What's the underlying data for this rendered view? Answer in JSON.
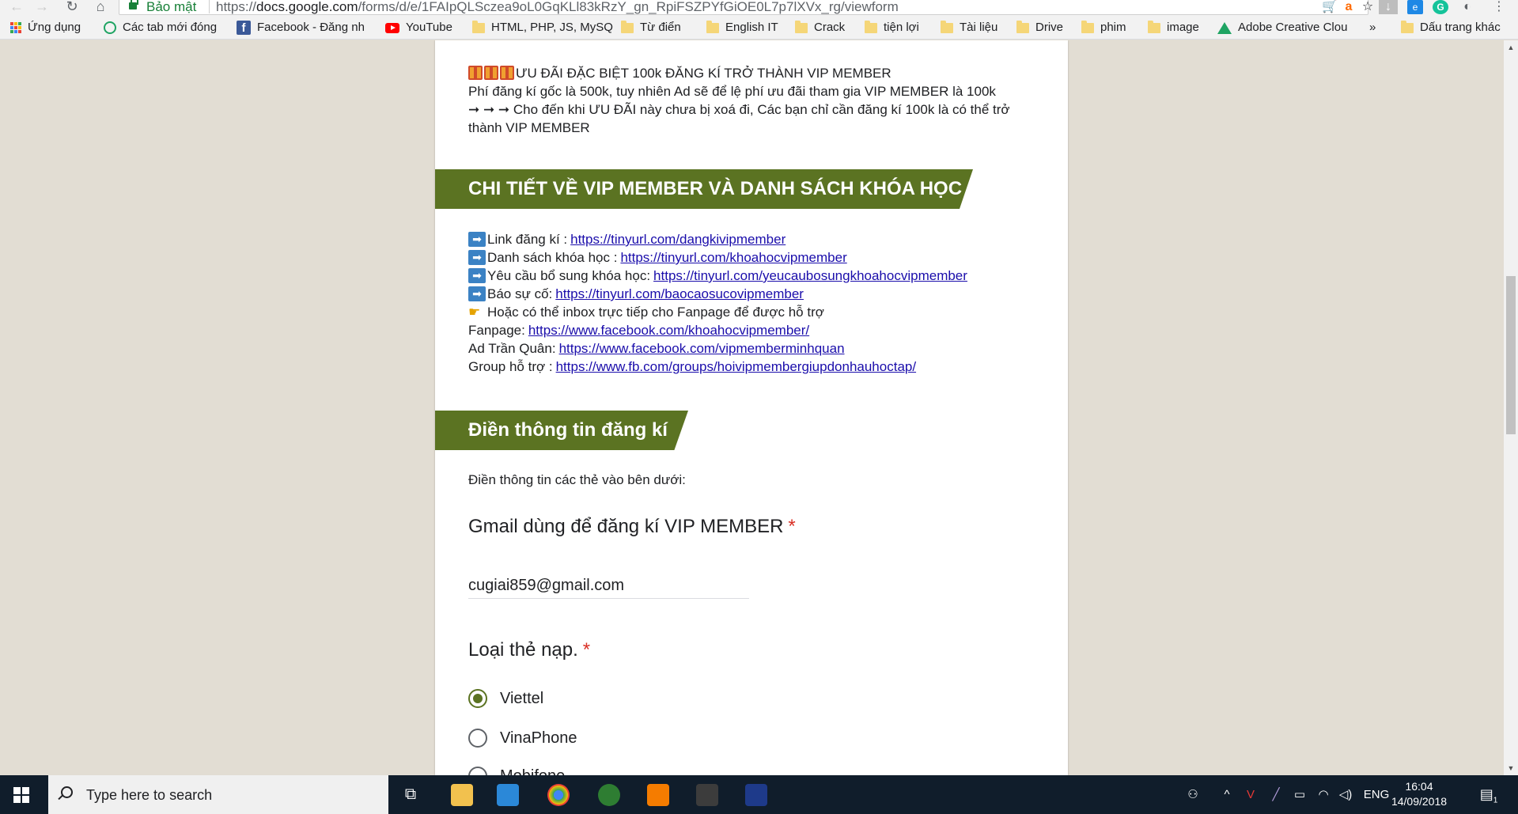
{
  "browser": {
    "secure_label": "Bảo mật",
    "url_scheme": "https://",
    "url_host": "docs.google.com",
    "url_path": "/forms/d/e/1FAIpQLSczea9oL0GqKLl83kRzY_gn_RpiFSZPYfGiOE0L7p7lXVx_rg/viewform",
    "bookmarks": {
      "apps": "Ứng dụng",
      "recent_tabs": "Các tab mới đóng",
      "facebook": "Facebook - Đăng nh",
      "youtube": "YouTube",
      "html": "HTML, PHP, JS, MySQ",
      "dictionary": "Từ điển",
      "english": "English IT",
      "crack": "Crack",
      "utilities": "tiện lợi",
      "documents": "Tài liệu",
      "drive": "Drive",
      "movies": "phim",
      "image": "image",
      "adobe": "Adobe Creative Clou",
      "more": "»",
      "other": "Dấu trang khác"
    }
  },
  "form": {
    "promo": {
      "headline": "ƯU ĐÃI ĐẶC BIỆT 100k ĐĂNG KÍ TRỞ THÀNH VIP MEMBER",
      "line2": "Phí đăng kí gốc là 500k, tuy nhiên Ad sẽ để lệ phí ưu đãi tham gia VIP MEMBER là 100k",
      "line3": "➞ ➞ ➞ Cho đến khi ƯU ĐÃI này chưa bị xoá đi, Các bạn chỉ cần đăng kí 100k là có thể trở thành VIP MEMBER"
    },
    "section1_title": "CHI TIẾT VỀ VIP MEMBER VÀ DANH SÁCH KHÓA HỌC",
    "links": [
      {
        "label": "Link đăng kí :",
        "url": "https://tinyurl.com/dangkivipmember",
        "icon": "arrow-box-icon"
      },
      {
        "label": "Danh sách khóa học :",
        "url": "https://tinyurl.com/khoahocvipmember",
        "icon": "arrow-box-icon"
      },
      {
        "label": "Yêu cầu bổ sung khóa học:",
        "url": "https://tinyurl.com/yeucaubosungkhoahocvipmember",
        "icon": "arrow-box-icon"
      },
      {
        "label": "Báo sự cố:",
        "url": "https://tinyurl.com/baocaosucovipmember",
        "icon": "arrow-box-icon"
      }
    ],
    "inbox_note": "Hoặc có thể inbox trực tiếp cho Fanpage để được hỗ trợ",
    "contacts": [
      {
        "label": "Fanpage:",
        "url": "https://www.facebook.com/khoahocvipmember/"
      },
      {
        "label": "Ad Trần Quân:",
        "url": "https://www.facebook.com/vipmemberminhquan"
      },
      {
        "label": "Group hỗ trợ :",
        "url": "https://www.fb.com/groups/hoivipmembergiupdonhauhoctap/"
      }
    ],
    "section2_title": "Điền thông tin đăng kí",
    "section2_intro": "Điền thông tin các thẻ vào bên dưới:",
    "q_email": {
      "title": "Gmail dùng để đăng kí VIP MEMBER",
      "required_mark": "*",
      "value": "cugiai859@gmail.com"
    },
    "q_card": {
      "title": "Loại thẻ nạp.",
      "required_mark": "*",
      "options": [
        "Viettel",
        "VinaPhone",
        "Mobifone"
      ],
      "selected": "Viettel"
    }
  },
  "taskbar": {
    "search_placeholder": "Type here to search",
    "language": "ENG",
    "time": "16:04",
    "date": "14/09/2018",
    "notification_count": "1"
  },
  "colors": {
    "accent": "#5b7322",
    "page_bg": "#e2ddd3",
    "link": "#1a0dab",
    "required": "#d93025"
  }
}
